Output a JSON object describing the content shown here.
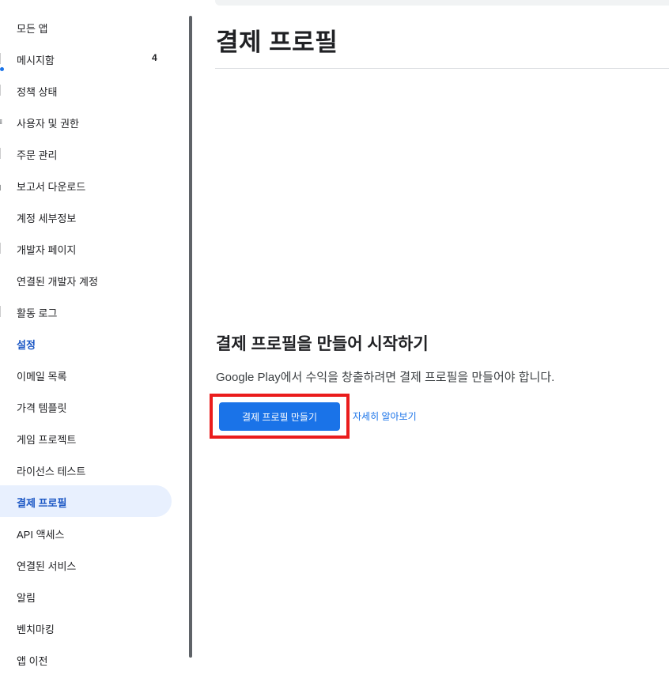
{
  "sidebar": {
    "items": [
      {
        "label": "모든 앱",
        "icon": "apps-icon"
      },
      {
        "label": "메시지함",
        "badge": "4",
        "icon": "inbox-icon"
      },
      {
        "label": "정책 상태",
        "icon": "policy-icon"
      },
      {
        "label": "사용자 및 권한",
        "icon": "people-icon"
      },
      {
        "label": "주문 관리",
        "icon": "orders-icon"
      },
      {
        "label": "보고서 다운로드",
        "icon": "download-icon"
      },
      {
        "label": "계정 세부정보",
        "icon": "account-icon"
      },
      {
        "label": "개발자 페이지",
        "icon": "developer-page-icon"
      },
      {
        "label": "연결된 개발자 계정",
        "icon": "linked-account-icon"
      },
      {
        "label": "활동 로그",
        "icon": "activity-log-icon"
      },
      {
        "label": "설정",
        "icon": "settings-icon"
      },
      {
        "label": "이메일 목록"
      },
      {
        "label": "가격 템플릿"
      },
      {
        "label": "게임 프로젝트"
      },
      {
        "label": "라이선스 테스트"
      },
      {
        "label": "결제 프로필"
      },
      {
        "label": "API 액세스"
      },
      {
        "label": "연결된 서비스"
      },
      {
        "label": "알림"
      },
      {
        "label": "벤치마킹"
      },
      {
        "label": "앱 이전"
      }
    ]
  },
  "main": {
    "title": "결제 프로필",
    "empty_state": {
      "heading": "결제 프로필을 만들어 시작하기",
      "description": "Google Play에서 수익을 창출하려면 결제 프로필을 만들어야 합니다.",
      "create_button": "결제 프로필 만들기",
      "learn_more": "자세히 알아보기"
    }
  },
  "colors": {
    "accent": "#1a73e8",
    "active_bg": "#e8f0fe",
    "highlight_box": "#ea1c1c"
  }
}
